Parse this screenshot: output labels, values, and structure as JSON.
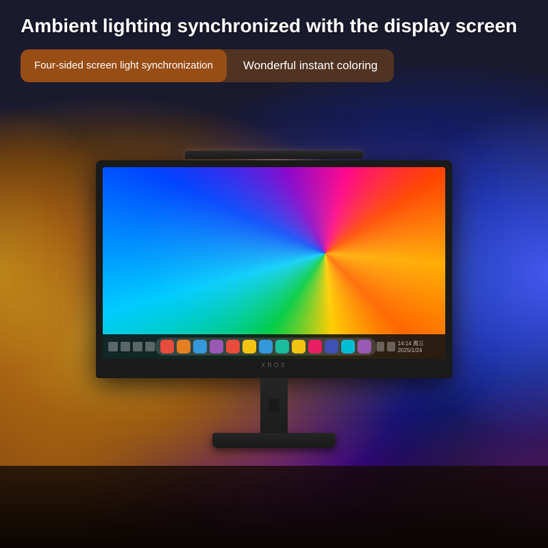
{
  "header": {
    "main_title": "Ambient lighting synchronized with the display screen",
    "pill_left": "Four-sided screen light synchronization",
    "pill_right": "Wonderful instant coloring"
  },
  "monitor": {
    "brand": "XROS",
    "taskbar": {
      "time": "14:14  周三\n2025/1/24"
    },
    "dock_icons": [
      {
        "color": "red",
        "label": "weibo"
      },
      {
        "color": "orange",
        "label": "photo"
      },
      {
        "color": "blue",
        "label": "search"
      },
      {
        "color": "purple",
        "label": "app1"
      },
      {
        "color": "red",
        "label": "heart"
      },
      {
        "color": "yellow",
        "label": "app2"
      },
      {
        "color": "blue",
        "label": "chrome"
      },
      {
        "color": "teal",
        "label": "app3"
      },
      {
        "color": "yellow",
        "label": "app4"
      },
      {
        "color": "pink",
        "label": "messages"
      },
      {
        "color": "indigo",
        "label": "music"
      },
      {
        "color": "cyan",
        "label": "app5"
      },
      {
        "color": "purple",
        "label": "app6"
      }
    ]
  },
  "colors": {
    "background_dark": "#0a0a14",
    "glow_left": "#c8901e",
    "glow_right": "#2040c0",
    "pill_left_bg": "#a05014",
    "pill_container_bg": "#64401e"
  }
}
